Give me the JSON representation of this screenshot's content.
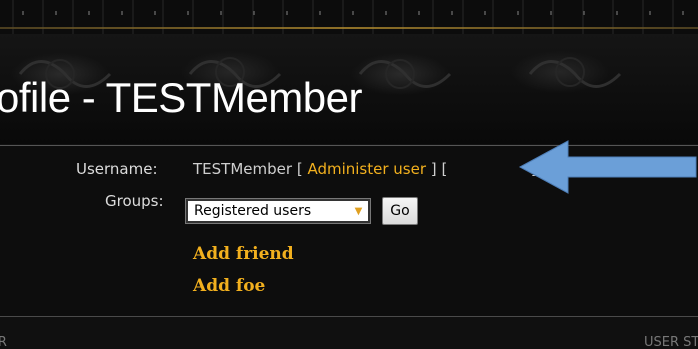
{
  "page": {
    "title": "ofile - TESTMember"
  },
  "profile": {
    "username_label": "Username:",
    "username_value": "TESTMember",
    "bracket_open": "[",
    "administer_link": "Administer user",
    "bracket_close": "]",
    "bracket_open_2": "[",
    "partial_bracket_close": "]",
    "groups_label": "Groups:",
    "groups_selected": "Registered users",
    "go_label": "Go",
    "add_friend": "Add friend",
    "add_foe": "Add foe"
  },
  "footer": {
    "left_text": "IR",
    "right_text": "USER ST"
  },
  "colors": {
    "link": "#f2b01e",
    "arrow": "#6b9fd8",
    "background": "#0d0d0d"
  },
  "icons": {
    "select_caret": "chevron-down-icon",
    "annotation": "arrow-left-icon"
  }
}
